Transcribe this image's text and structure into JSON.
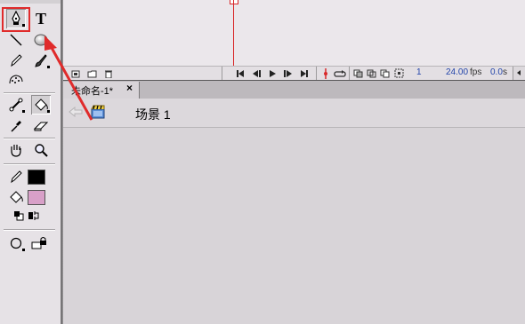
{
  "toolbar": {
    "tools": [
      {
        "name": "pen-tool",
        "active": true
      },
      {
        "name": "text-tool",
        "label": "T"
      },
      {
        "name": "line-tool"
      },
      {
        "name": "oval-tool"
      },
      {
        "name": "pencil-tool"
      },
      {
        "name": "brush-tool"
      },
      {
        "name": "spray-brush-tool"
      },
      {
        "name": "bone-tool"
      },
      {
        "name": "paint-bucket-tool",
        "active": true
      },
      {
        "name": "eyedropper-tool"
      },
      {
        "name": "eraser-tool"
      },
      {
        "name": "hand-tool"
      },
      {
        "name": "zoom-tool"
      }
    ],
    "stroke_color": "#000000",
    "fill_color": "#d8a0c8"
  },
  "timeline": {
    "frame_number": "1",
    "frame_rate": "24.00",
    "frame_rate_unit": "fps",
    "elapsed_time": "0.0",
    "elapsed_time_unit": "s"
  },
  "document": {
    "tab_title": "未命名-1*",
    "tab_close": "×",
    "scene_name": "场景 1"
  },
  "annotation": {
    "highlight_color": "#e02b2b"
  }
}
